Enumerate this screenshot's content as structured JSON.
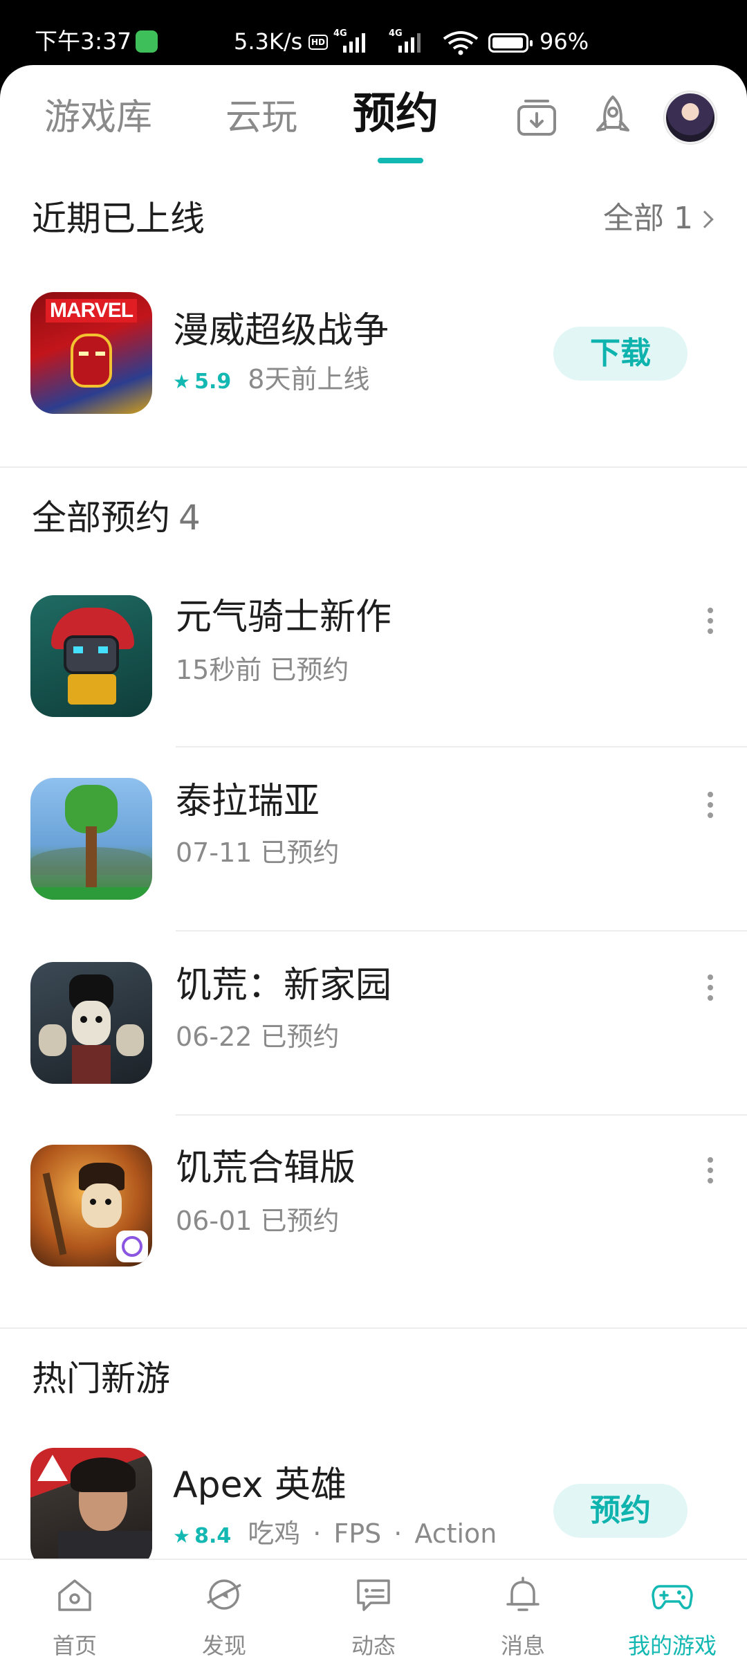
{
  "status_bar": {
    "time": "下午3:37",
    "net_speed": "5.3K/s",
    "signal1_tag": "4G",
    "signal2_tag": "4G",
    "battery": "96%"
  },
  "top_tabs": [
    {
      "label": "游戏库",
      "active": false
    },
    {
      "label": "云玩",
      "active": false
    },
    {
      "label": "预约",
      "active": true
    }
  ],
  "recent": {
    "title": "近期已上线",
    "more_label": "全部 1",
    "item": {
      "name": "漫威超级战争",
      "rating": "5.9",
      "meta": "8天前上线",
      "action": "下载",
      "icon_text": "MARVEL"
    }
  },
  "reserved": {
    "title": "全部预约",
    "count": "4",
    "items": [
      {
        "name": "元气骑士新作",
        "meta": "15秒前 已预约"
      },
      {
        "name": "泰拉瑞亚",
        "meta": "07-11 已预约"
      },
      {
        "name": "饥荒：新家园",
        "meta": "06-22 已预约"
      },
      {
        "name": "饥荒合辑版",
        "meta": "06-01 已预约"
      }
    ]
  },
  "hot": {
    "title": "热门新游",
    "item": {
      "name": "Apex 英雄",
      "rating": "8.4",
      "tags": [
        "吃鸡",
        "FPS",
        "Action"
      ],
      "action": "预约"
    }
  },
  "bottom_nav": [
    {
      "label": "首页",
      "icon": "home-icon",
      "active": false
    },
    {
      "label": "发现",
      "icon": "discover-icon",
      "active": false
    },
    {
      "label": "动态",
      "icon": "feed-icon",
      "active": false
    },
    {
      "label": "消息",
      "icon": "bell-icon",
      "active": false
    },
    {
      "label": "我的游戏",
      "icon": "gamepad-icon",
      "active": true
    }
  ],
  "colors": {
    "accent": "#14b8b2",
    "pill_bg": "#e3f6f6",
    "text_primary": "#1e1e1e",
    "text_secondary": "#8a8a8a"
  }
}
